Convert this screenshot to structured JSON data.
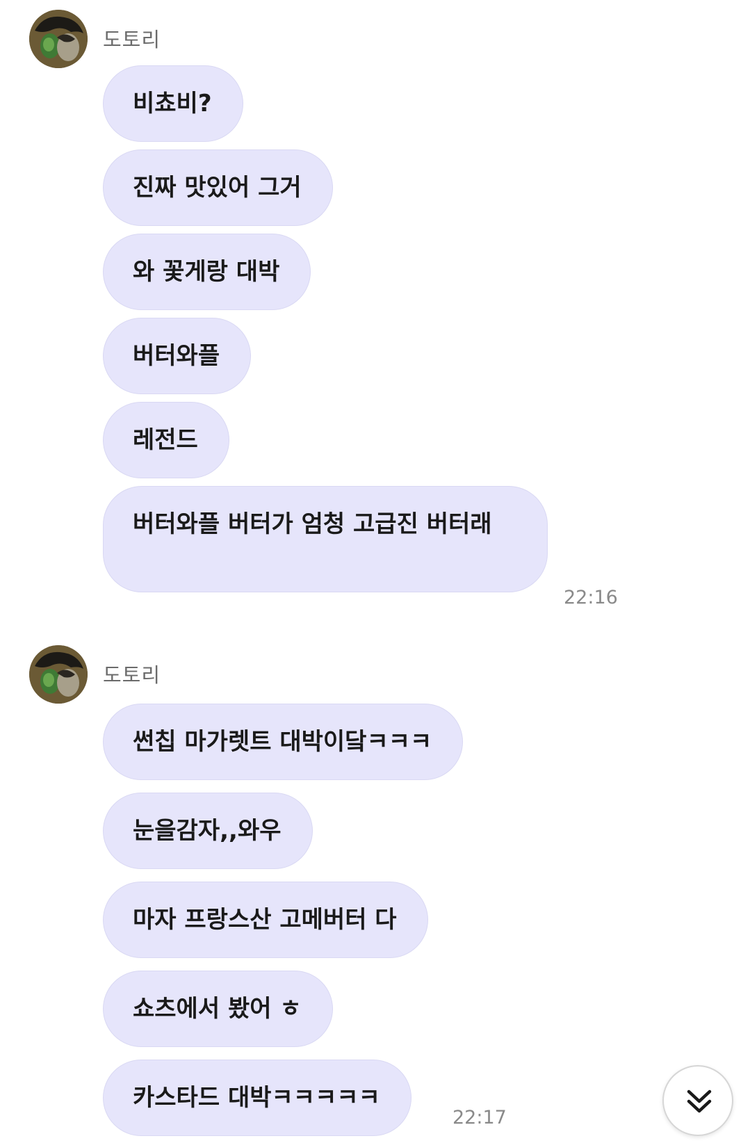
{
  "groups": [
    {
      "sender": "도토리",
      "messages": [
        "비쵸비?",
        "진짜 맛있어 그거",
        "와 꽃게랑 대박",
        "버터와플",
        "레전드",
        "버터와플 버터가 엄청 고급진 버터래"
      ],
      "time": "22:16"
    },
    {
      "sender": "도토리",
      "messages": [
        "썬칩 마가렛트 대박이닼ㅋㅋㅋ",
        "눈을감자,,와우",
        "마자 프랑스산 고메버터 다",
        "쇼츠에서 봤어 ㅎ",
        "카스타드 대박ㅋㅋㅋㅋㅋ"
      ],
      "time": "22:17"
    }
  ],
  "icons": {
    "avatar": "profile-avatar",
    "scroll_down": "double-chevron-down-icon"
  },
  "colors": {
    "bubble_bg": "#e6e5fb",
    "sender_text": "#6b6b6b",
    "time_text": "#8a8a8a"
  }
}
